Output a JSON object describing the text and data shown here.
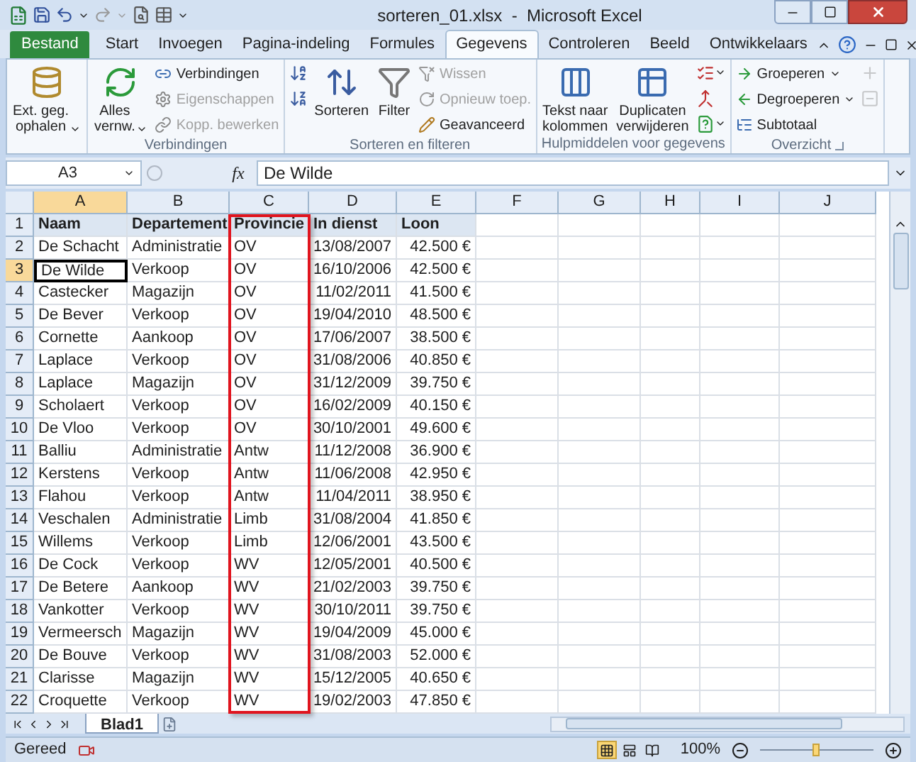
{
  "window": {
    "title": "sorteren_01.xlsx  -  Microsoft Excel"
  },
  "ribbon_tabs": [
    {
      "label": "Bestand",
      "kind": "file",
      "selected": false
    },
    {
      "label": "Start",
      "kind": "tab",
      "selected": false
    },
    {
      "label": "Invoegen",
      "kind": "tab",
      "selected": false
    },
    {
      "label": "Pagina-indeling",
      "kind": "tab",
      "selected": false
    },
    {
      "label": "Formules",
      "kind": "tab",
      "selected": false
    },
    {
      "label": "Gegevens",
      "kind": "tab",
      "selected": true
    },
    {
      "label": "Controleren",
      "kind": "tab",
      "selected": false
    },
    {
      "label": "Beeld",
      "kind": "tab",
      "selected": false
    },
    {
      "label": "Ontwikkelaars",
      "kind": "tab",
      "selected": false
    }
  ],
  "ribbon_groups": [
    {
      "launcher": false,
      "columns": [
        {
          "kind": "large",
          "items": [
            {
              "label": "Ext. geg.\nophalen",
              "dropdown": true,
              "disabled": false
            }
          ]
        }
      ]
    },
    {
      "label": "Verbindingen",
      "launcher": false,
      "columns": [
        {
          "kind": "large",
          "items": [
            {
              "label": "Alles\nvernw.",
              "dropdown": true,
              "disabled": false
            }
          ]
        },
        {
          "kind": "stack",
          "items": [
            {
              "label": "Verbindingen",
              "dropdown": false,
              "disabled": false
            },
            {
              "label": "Eigenschappen",
              "dropdown": false,
              "disabled": true
            },
            {
              "label": "Kopp. bewerken",
              "dropdown": false,
              "disabled": true
            }
          ]
        }
      ]
    },
    {
      "label": "Sorteren en filteren",
      "launcher": false,
      "columns": [
        {
          "kind": "icons",
          "items": [
            {
              "dropdown": false,
              "disabled": false
            },
            {
              "dropdown": false,
              "disabled": false
            }
          ]
        },
        {
          "kind": "large",
          "items": [
            {
              "label": "Sorteren",
              "dropdown": false,
              "disabled": false
            }
          ]
        },
        {
          "kind": "large",
          "items": [
            {
              "label": "Filter",
              "dropdown": false,
              "disabled": false
            }
          ]
        },
        {
          "kind": "stack",
          "items": [
            {
              "label": "Wissen",
              "dropdown": false,
              "disabled": true
            },
            {
              "label": "Opnieuw toep.",
              "dropdown": false,
              "disabled": true
            },
            {
              "label": "Geavanceerd",
              "dropdown": false,
              "disabled": false
            }
          ]
        }
      ]
    },
    {
      "label": "Hulpmiddelen voor gegevens",
      "launcher": false,
      "columns": [
        {
          "kind": "large",
          "items": [
            {
              "label": "Tekst naar\nkolommen",
              "dropdown": false,
              "disabled": false
            }
          ]
        },
        {
          "kind": "large",
          "items": [
            {
              "label": "Duplicaten\nverwijderen",
              "dropdown": false,
              "disabled": false
            }
          ]
        },
        {
          "kind": "icons",
          "items": [
            {
              "dropdown": true,
              "disabled": false
            },
            {
              "dropdown": false,
              "disabled": false
            },
            {
              "dropdown": true,
              "disabled": false
            }
          ]
        }
      ]
    },
    {
      "label": "Overzicht",
      "launcher": true,
      "columns": [
        {
          "kind": "stack",
          "items": [
            {
              "label": "Groeperen",
              "dropdown": true,
              "disabled": false
            },
            {
              "label": "Degroeperen",
              "dropdown": true,
              "disabled": false
            },
            {
              "label": "Subtotaal",
              "dropdown": false,
              "disabled": false
            }
          ]
        },
        {
          "kind": "icons",
          "items": [
            {
              "dropdown": false,
              "disabled": true
            },
            {
              "dropdown": false,
              "disabled": true
            }
          ]
        }
      ]
    }
  ],
  "formula_bar": {
    "name_box": "A3",
    "function_label": "fx",
    "value": "De Wilde"
  },
  "sheet": {
    "columns": [
      {
        "label": "A",
        "kind": "text",
        "selected": true,
        "highlighted": false
      },
      {
        "label": "B",
        "kind": "text",
        "selected": false,
        "highlighted": false
      },
      {
        "label": "C",
        "kind": "text",
        "selected": false,
        "highlighted": true
      },
      {
        "label": "D",
        "kind": "number",
        "selected": false,
        "highlighted": false
      },
      {
        "label": "E",
        "kind": "number",
        "selected": false,
        "highlighted": false
      },
      {
        "label": "F",
        "kind": "text",
        "selected": false,
        "highlighted": false
      },
      {
        "label": "G",
        "kind": "text",
        "selected": false,
        "highlighted": false
      },
      {
        "label": "H",
        "kind": "text",
        "selected": false,
        "highlighted": false
      },
      {
        "label": "I",
        "kind": "text",
        "selected": false,
        "highlighted": false
      },
      {
        "label": "J",
        "kind": "text",
        "selected": false,
        "highlighted": false
      }
    ],
    "rows": [
      {
        "number": "1",
        "kind": "header",
        "selected": false,
        "cells": [
          "Naam",
          "Departement",
          "Provincie",
          "In dienst",
          "Loon"
        ]
      },
      {
        "number": "2",
        "kind": "data",
        "selected": false,
        "cells": [
          "De Schacht",
          "Administratie",
          "OV",
          "13/08/2007",
          "42.500 €"
        ]
      },
      {
        "number": "3",
        "kind": "data",
        "selected": true,
        "cells": [
          "De Wilde",
          "Verkoop",
          "OV",
          "16/10/2006",
          "42.500 €"
        ]
      },
      {
        "number": "4",
        "kind": "data",
        "selected": false,
        "cells": [
          "Castecker",
          "Magazijn",
          "OV",
          "11/02/2011",
          "41.500 €"
        ]
      },
      {
        "number": "5",
        "kind": "data",
        "selected": false,
        "cells": [
          "De Bever",
          "Verkoop",
          "OV",
          "19/04/2010",
          "48.500 €"
        ]
      },
      {
        "number": "6",
        "kind": "data",
        "selected": false,
        "cells": [
          "Cornette",
          "Aankoop",
          "OV",
          "17/06/2007",
          "38.500 €"
        ]
      },
      {
        "number": "7",
        "kind": "data",
        "selected": false,
        "cells": [
          "Laplace",
          "Verkoop",
          "OV",
          "31/08/2006",
          "40.850 €"
        ]
      },
      {
        "number": "8",
        "kind": "data",
        "selected": false,
        "cells": [
          "Laplace",
          "Magazijn",
          "OV",
          "31/12/2009",
          "39.750 €"
        ]
      },
      {
        "number": "9",
        "kind": "data",
        "selected": false,
        "cells": [
          "Scholaert",
          "Verkoop",
          "OV",
          "16/02/2009",
          "40.150 €"
        ]
      },
      {
        "number": "10",
        "kind": "data",
        "selected": false,
        "cells": [
          "De Vloo",
          "Verkoop",
          "OV",
          "30/10/2001",
          "49.600 €"
        ]
      },
      {
        "number": "11",
        "kind": "data",
        "selected": false,
        "cells": [
          "Balliu",
          "Administratie",
          "Antw",
          "11/12/2008",
          "36.900 €"
        ]
      },
      {
        "number": "12",
        "kind": "data",
        "selected": false,
        "cells": [
          "Kerstens",
          "Verkoop",
          "Antw",
          "11/06/2008",
          "42.950 €"
        ]
      },
      {
        "number": "13",
        "kind": "data",
        "selected": false,
        "cells": [
          "Flahou",
          "Verkoop",
          "Antw",
          "11/04/2011",
          "38.950 €"
        ]
      },
      {
        "number": "14",
        "kind": "data",
        "selected": false,
        "cells": [
          "Veschalen",
          "Administratie",
          "Limb",
          "31/08/2004",
          "41.850 €"
        ]
      },
      {
        "number": "15",
        "kind": "data",
        "selected": false,
        "cells": [
          "Willems",
          "Verkoop",
          "Limb",
          "12/06/2001",
          "43.500 €"
        ]
      },
      {
        "number": "16",
        "kind": "data",
        "selected": false,
        "cells": [
          "De Cock",
          "Verkoop",
          "WV",
          "12/05/2001",
          "40.500 €"
        ]
      },
      {
        "number": "17",
        "kind": "data",
        "selected": false,
        "cells": [
          "De Betere",
          "Aankoop",
          "WV",
          "21/02/2003",
          "39.750 €"
        ]
      },
      {
        "number": "18",
        "kind": "data",
        "selected": false,
        "cells": [
          "Vankotter",
          "Verkoop",
          "WV",
          "30/10/2011",
          "39.750 €"
        ]
      },
      {
        "number": "19",
        "kind": "data",
        "selected": false,
        "cells": [
          "Vermeersch",
          "Magazijn",
          "WV",
          "19/04/2009",
          "45.000 €"
        ]
      },
      {
        "number": "20",
        "kind": "data",
        "selected": false,
        "cells": [
          "De Bouve",
          "Verkoop",
          "WV",
          "31/08/2003",
          "52.000 €"
        ]
      },
      {
        "number": "21",
        "kind": "data",
        "selected": false,
        "cells": [
          "Clarisse",
          "Magazijn",
          "WV",
          "15/12/2005",
          "40.650 €"
        ]
      },
      {
        "number": "22",
        "kind": "data",
        "selected": false,
        "cells": [
          "Croquette",
          "Verkoop",
          "WV",
          "19/02/2003",
          "47.850 €"
        ]
      }
    ]
  },
  "sheet_tabs": [
    {
      "label": "Blad1",
      "selected": true
    }
  ],
  "status_bar": {
    "status": "Gereed",
    "views": [
      {
        "selected": true
      },
      {
        "selected": false
      },
      {
        "selected": false
      }
    ],
    "zoom": {
      "reading": "100%",
      "level": 0.5
    }
  }
}
